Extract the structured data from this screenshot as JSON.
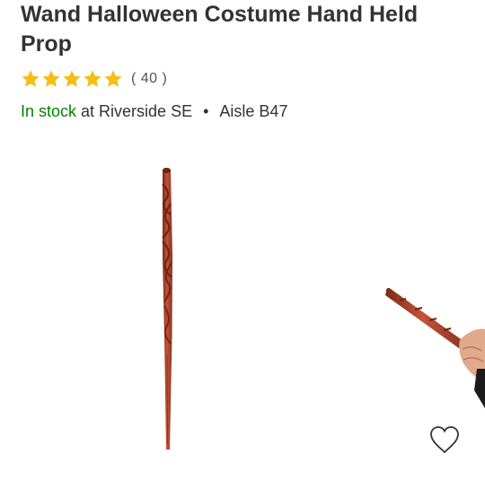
{
  "product": {
    "title": "Wand Halloween Costume Hand Held Prop",
    "rating_stars": 5,
    "review_count": "( 40 )"
  },
  "availability": {
    "status": "In stock",
    "store_prefix": "at",
    "store": "Riverside SE",
    "separator": "•",
    "aisle": "Aisle B47"
  },
  "colors": {
    "star": "#f6bd16",
    "in_stock": "#008300",
    "wand": "#b5452a"
  },
  "icons": {
    "favorite": "heart-outline-icon"
  }
}
